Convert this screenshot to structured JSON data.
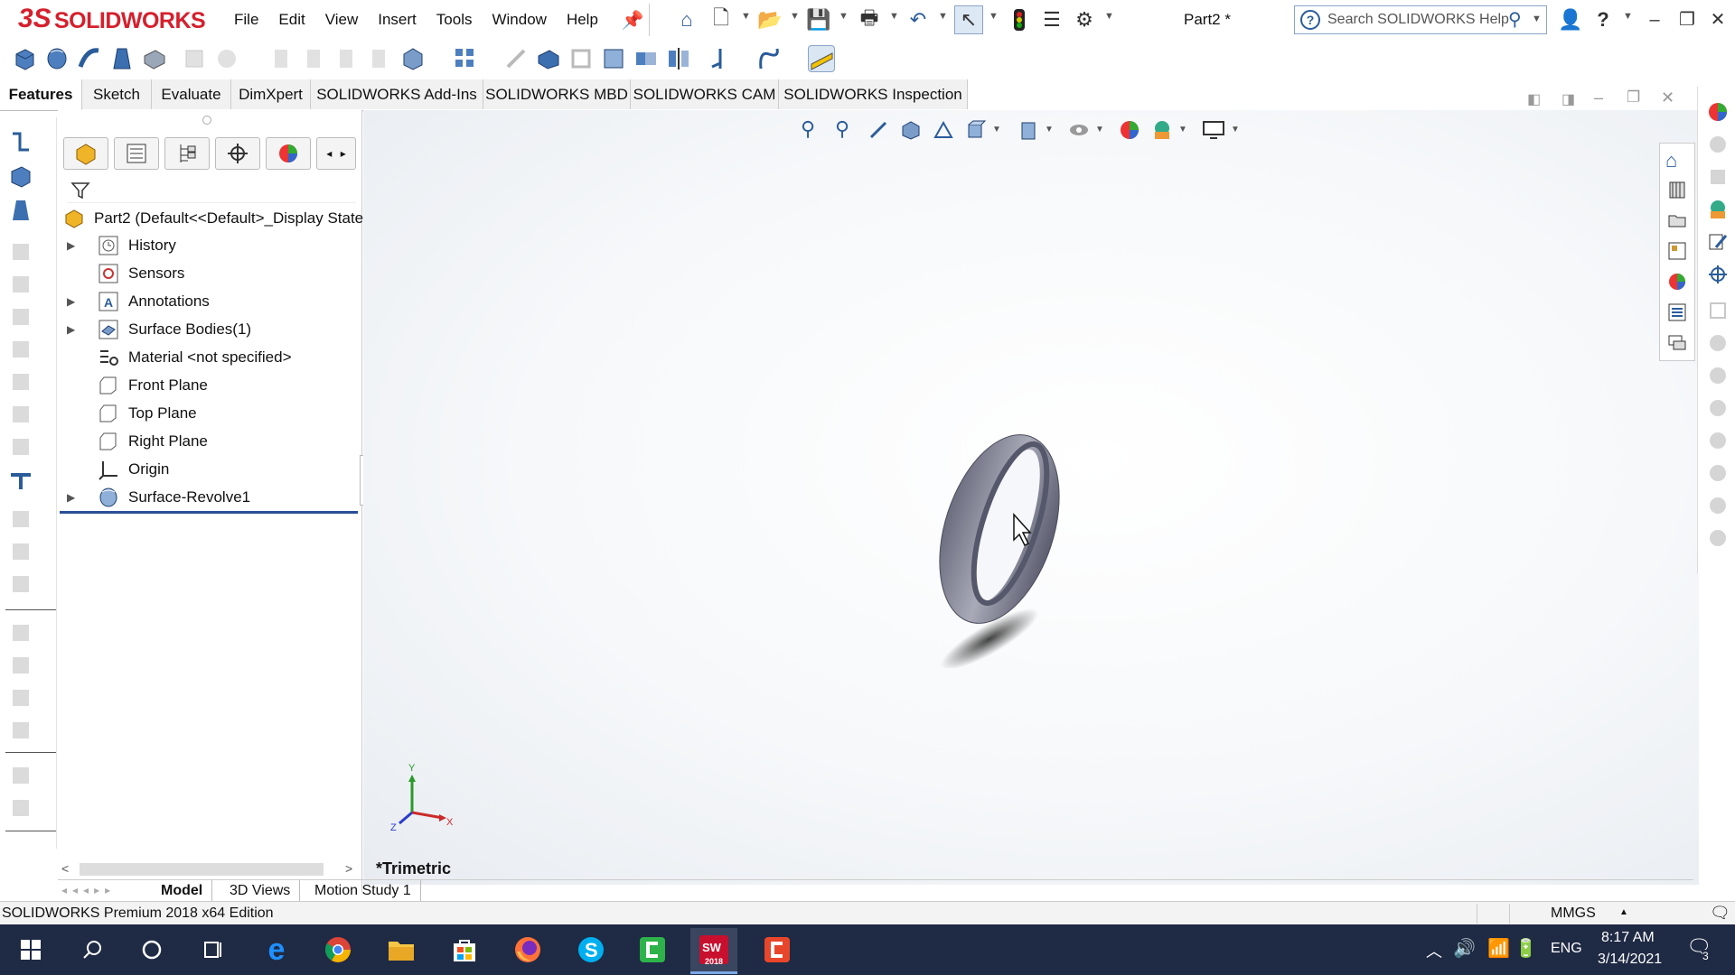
{
  "app": {
    "brand_prefix": "3S",
    "brand_name": "SOLIDWORKS",
    "doc_title": "Part2 *"
  },
  "menu": [
    "File",
    "Edit",
    "View",
    "Insert",
    "Tools",
    "Window",
    "Help"
  ],
  "help_search": {
    "placeholder": "Search SOLIDWORKS Help"
  },
  "command_tabs": [
    "Features",
    "Sketch",
    "Evaluate",
    "DimXpert",
    "SOLIDWORKS Add-Ins",
    "SOLIDWORKS MBD",
    "SOLIDWORKS CAM",
    "SOLIDWORKS Inspection"
  ],
  "feature_tree": {
    "root": "Part2  (Default<<Default>_Display State",
    "items": [
      {
        "label": "History",
        "expandable": true,
        "icon": "history-icon"
      },
      {
        "label": "Sensors",
        "expandable": false,
        "icon": "sensor-icon"
      },
      {
        "label": "Annotations",
        "expandable": true,
        "icon": "annotation-icon"
      },
      {
        "label": "Surface Bodies(1)",
        "expandable": true,
        "icon": "surface-bodies-icon"
      },
      {
        "label": "Material <not specified>",
        "expandable": false,
        "icon": "material-icon"
      },
      {
        "label": "Front Plane",
        "expandable": false,
        "icon": "plane-icon"
      },
      {
        "label": "Top Plane",
        "expandable": false,
        "icon": "plane-icon"
      },
      {
        "label": "Right Plane",
        "expandable": false,
        "icon": "plane-icon"
      },
      {
        "label": "Origin",
        "expandable": false,
        "icon": "origin-icon"
      },
      {
        "label": "Surface-Revolve1",
        "expandable": true,
        "icon": "revolve-icon"
      }
    ]
  },
  "viewport": {
    "view_orientation": "*Trimetric",
    "triad": {
      "x": "X",
      "y": "Y",
      "z": "Z"
    }
  },
  "bottom_tabs": [
    "Model",
    "3D Views",
    "Motion Study 1"
  ],
  "status": {
    "edition": "SOLIDWORKS Premium 2018 x64 Edition",
    "units": "MMGS"
  },
  "taskbar": {
    "time": "8:17 AM",
    "date": "3/14/2021",
    "language": "ENG",
    "notification_count": "3",
    "sw_badge": "2018"
  },
  "colors": {
    "brand_red": "#d5202d",
    "accent_blue": "#2a5c9a",
    "taskbar": "#1f2a44"
  }
}
